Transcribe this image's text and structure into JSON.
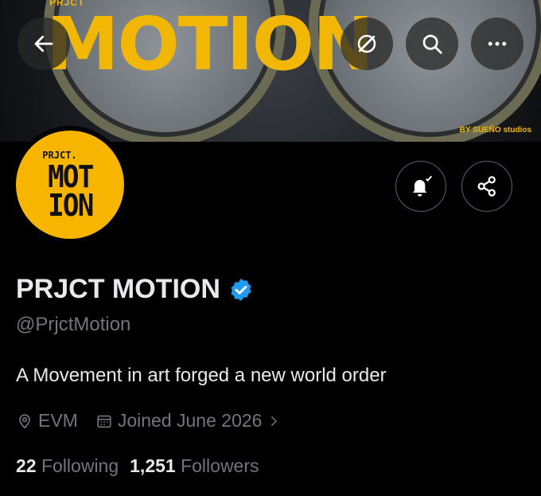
{
  "banner": {
    "brand": "PRJCT",
    "title": "MOTION",
    "subtitle": "BY SUEÑO studios"
  },
  "nav": {
    "back_icon": "arrow-left-icon",
    "grok_icon": "slash-circle-icon",
    "search_icon": "search-icon",
    "more_icon": "more-dots-icon"
  },
  "avatar": {
    "small_text": "PRJCT.",
    "line1": "MOT",
    "line2": "ION",
    "color": "#f7b500"
  },
  "actions": {
    "notify_icon": "bell-check-icon",
    "share_icon": "share-icon"
  },
  "profile": {
    "name": "PRJCT MOTION",
    "handle": "@PrjctMotion",
    "bio": "A Movement in art forged a new world order",
    "location": "EVM",
    "joined": "Joined June 2026",
    "verified_color": "#1d9bf0"
  },
  "stats": {
    "following_count": "22",
    "following_label": "Following",
    "followers_count": "1,251",
    "followers_label": "Followers"
  }
}
